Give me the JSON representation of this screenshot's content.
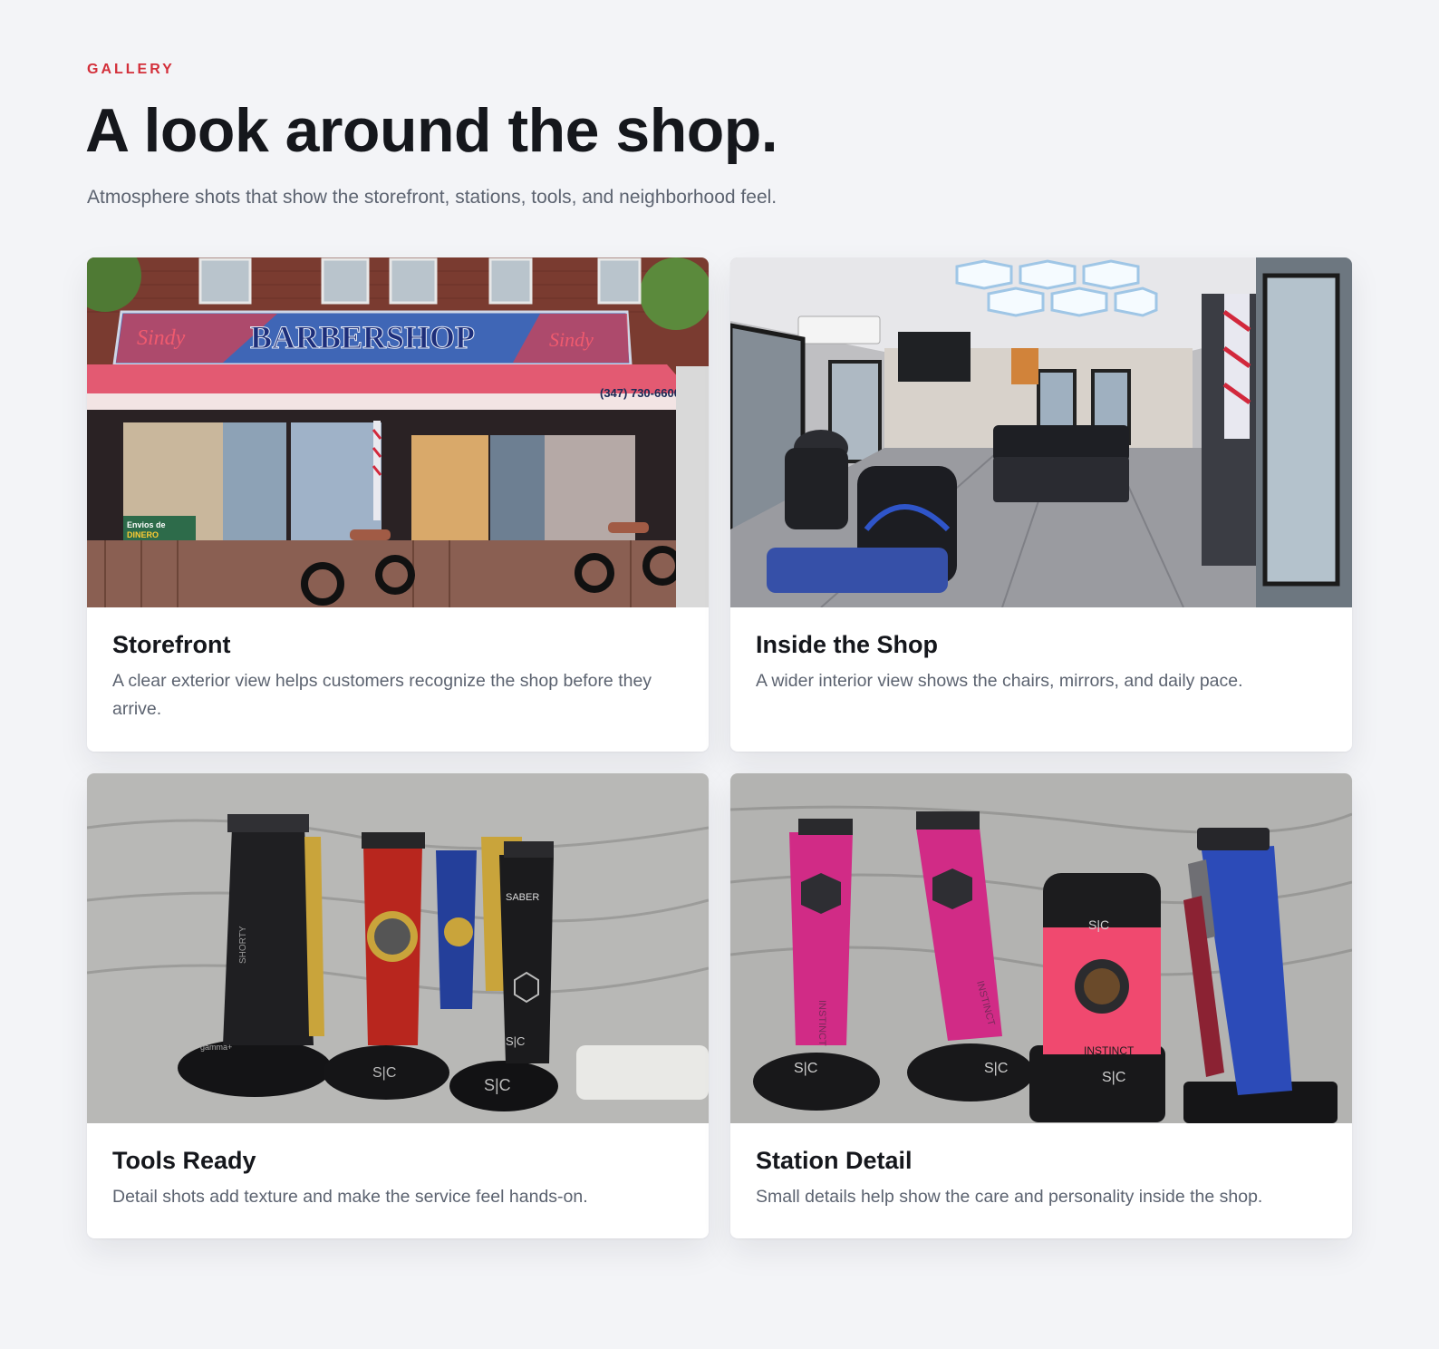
{
  "header": {
    "eyebrow": "GALLERY",
    "title": "A look around the shop.",
    "subtitle": "Atmosphere shots that show the storefront, stations, tools, and neighborhood feel."
  },
  "cards": [
    {
      "title": "Storefront",
      "description": "A clear exterior view helps customers recognize the shop before they arrive.",
      "photo": {
        "sign_left": "Sindy",
        "sign_main": "BARBERSHOP",
        "sign_right": "Sindy",
        "phone": "(347) 730-6600",
        "window_text_1": "Envios de",
        "window_text_2": "DINERO"
      }
    },
    {
      "title": "Inside the Shop",
      "description": "A wider interior view shows the chairs, mirrors, and daily pace."
    },
    {
      "title": "Tools Ready",
      "description": "Detail shots add texture and make the service feel hands-on.",
      "photo": {
        "brand_1": "SHORTY",
        "brand_2": "SABER",
        "base_1": "S|C",
        "base_2": "S|C",
        "base_3": "S|C",
        "gamma": "gamma+"
      }
    },
    {
      "title": "Station Detail",
      "description": "Small details help show the care and personality inside the shop.",
      "photo": {
        "label_1": "INSTINCT",
        "label_2": "INSTINCT",
        "label_3": "INSTINCT",
        "base_1": "S|C",
        "base_2": "S|C",
        "base_3": "S|C",
        "base_4": "S|C"
      }
    }
  ],
  "colors": {
    "accent": "#d32f3a",
    "background": "#f3f4f7",
    "heading": "#15171c",
    "body": "#5c6370"
  }
}
